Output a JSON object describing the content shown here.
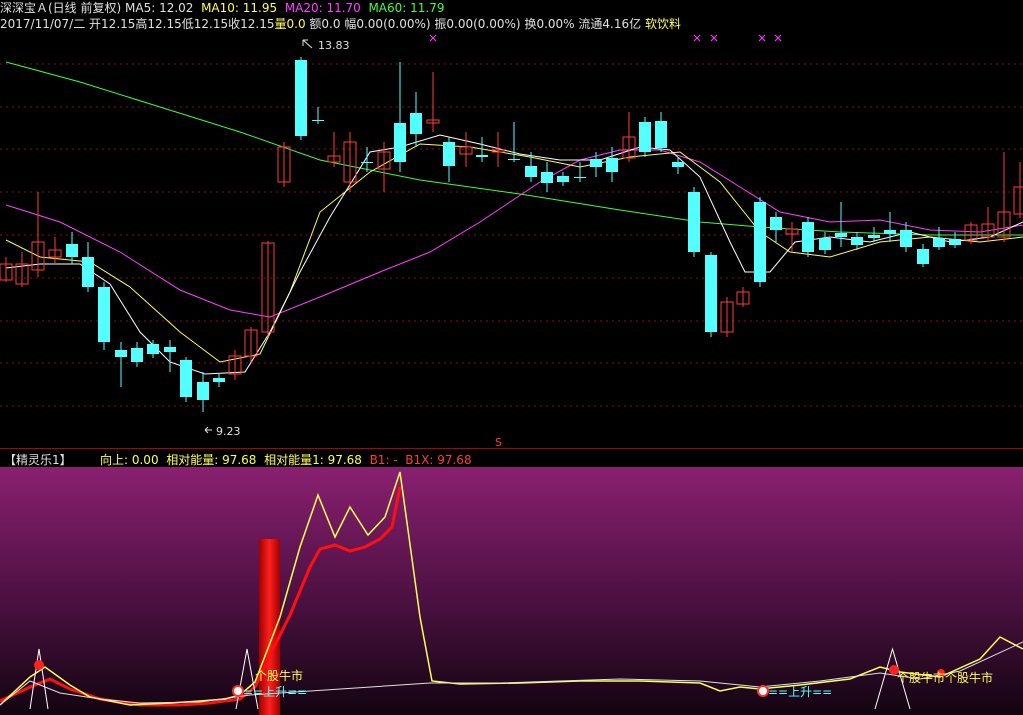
{
  "header": {
    "stock_name": "深深宝Ａ(日线 前复权)",
    "ma5": "MA5: 12.02",
    "ma10": "MA10: 11.95",
    "ma20": "MA20: 11.70",
    "ma60": "MA60: 11.79",
    "date": "2017/11/07/二",
    "open": "开12.15",
    "high": "高12.15",
    "low": "低12.15",
    "close": "收12.15",
    "volume_label": "量",
    "volume_value": "0.0",
    "amount": "额0.0",
    "change": "幅0.00(0.00%)",
    "amplitude": "振0.00(0.00%)",
    "turnover": "换0.00%",
    "float": "流通4.16亿",
    "sector": "软饮料"
  },
  "main_chart": {
    "high_label": "13.83",
    "low_label": "9.23",
    "marker_s": "S",
    "colors": {
      "up": "#ff3c3c",
      "down": "#54ffff",
      "ma5": "#ffffff",
      "ma10": "#ffff54",
      "ma20": "#ff40ff",
      "ma60": "#3cff3c"
    }
  },
  "indicator": {
    "title": "【精灵乐1】",
    "up": "向上: 0.00",
    "energy": "相对能量: 97.68",
    "energy1": "相对能量1: 97.68",
    "b1": "B1: -",
    "b1x": "B1X: 97.68",
    "labels": {
      "bull1": "个股牛市",
      "bull2": "个股牛市",
      "bull3": "个股牛市",
      "rise1": "==上升==",
      "rise2": "==上升=="
    }
  }
}
